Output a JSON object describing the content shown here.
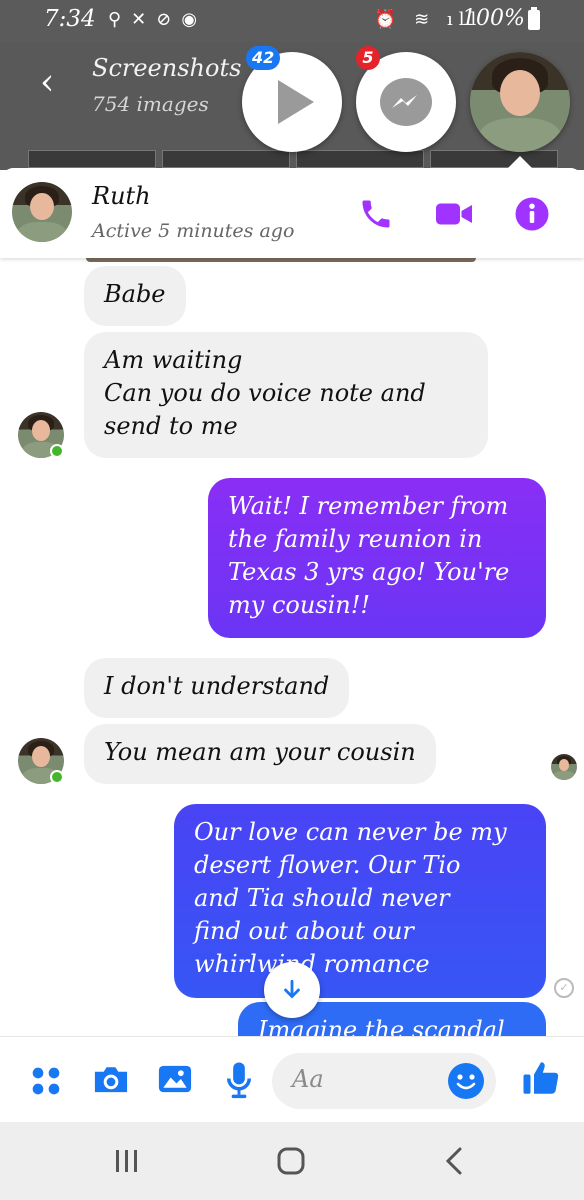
{
  "status_bar": {
    "time": "7:34",
    "left_icons": "⚲✕⊘◉",
    "right_icons": "⏰ ≋ ıll",
    "battery": "100%"
  },
  "gallery": {
    "title": "Screenshots",
    "count": "754 images"
  },
  "chat_heads": {
    "play_badge": "42",
    "messenger_badge": "5"
  },
  "chat_header": {
    "contact_name": "Ruth",
    "active_status": "Active 5 minutes ago"
  },
  "messages": [
    {
      "from": "them",
      "text": "Babe"
    },
    {
      "from": "them",
      "text": "Am waiting\nCan you do voice note and\nsend to me"
    },
    {
      "from": "me",
      "text": "Wait! I remember from\nthe family reunion in\nTexas 3 yrs ago! You're\nmy cousin!!"
    },
    {
      "from": "them",
      "text": "I don't understand"
    },
    {
      "from": "them",
      "text": "You mean am your cousin"
    },
    {
      "from": "me",
      "text": "Our love can never be my\ndesert flower. Our Tio\nand Tia should never\nfind out about our\nwhirlwind romance"
    },
    {
      "from": "me",
      "text": "Imagine the scandal"
    }
  ],
  "composer": {
    "placeholder": "Aa"
  },
  "colors": {
    "accent_purple": "#a033ff",
    "messenger_blue": "#1877f2",
    "bubble_purple_top": "#8d2cf5",
    "bubble_blue": "#3a4cf5",
    "incoming_bubble": "#f0f0f0"
  },
  "icons": [
    "phone-icon",
    "video-icon",
    "info-icon",
    "apps-icon",
    "camera-icon",
    "gallery-icon",
    "mic-icon",
    "emoji-icon",
    "thumbs-up-icon",
    "arrow-down-icon",
    "recents-icon",
    "home-icon",
    "back-icon"
  ]
}
